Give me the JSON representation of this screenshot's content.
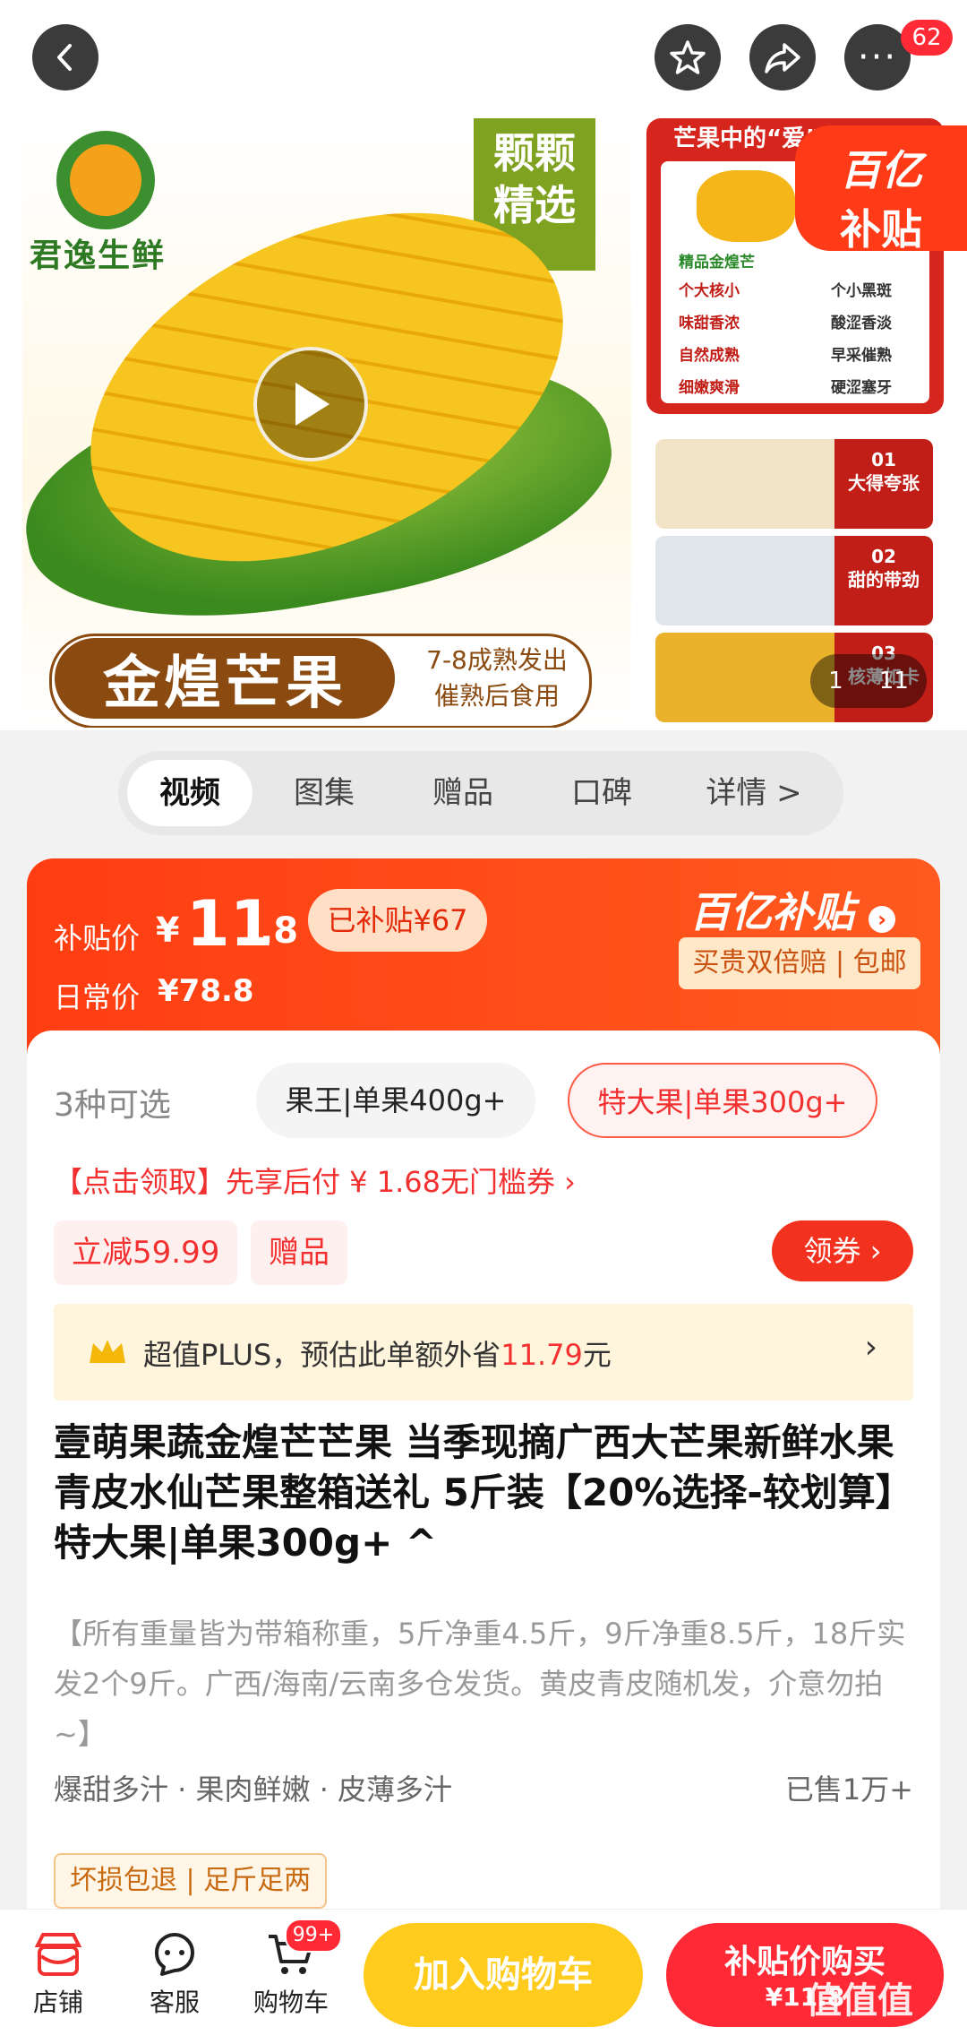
{
  "header": {
    "notification_count": "62"
  },
  "gallery": {
    "brand_name": "君逸生鲜",
    "select_tag": "颗颗精选",
    "product_banner": "金煌芒果",
    "ripe_note_1": "7-8成熟发出",
    "ripe_note_2": "催熟后食用",
    "side_title": "芒果中的“爱”",
    "side_good": [
      "精品金煌芒",
      "个大核小",
      "味甜香浓",
      "自然成熟",
      "细嫩爽滑"
    ],
    "side_bad": [
      "个小黑斑",
      "酸涩香淡",
      "早采催熟",
      "硬涩塞牙"
    ],
    "yi_badge_line1": "百亿",
    "yi_badge_line2": "补贴",
    "thumbs": [
      {
        "num": "01",
        "label": "大得夸张"
      },
      {
        "num": "02",
        "label": "甜的带劲"
      },
      {
        "num": "03",
        "label": "核薄如卡"
      }
    ],
    "page_current": "1",
    "page_total": "11"
  },
  "tabs": [
    "视频",
    "图集",
    "赠品",
    "口碑",
    "详情 >"
  ],
  "price": {
    "subsidy_label": "补贴价",
    "currency": "¥",
    "subsidy_int": "11",
    "subsidy_dec": ".8",
    "subsidized_badge": "已补贴¥67",
    "daily_label": "日常价",
    "daily_price": "¥78.8",
    "yi_title": "百亿补贴",
    "yi_sub": "买贵双倍赔 | 包邮"
  },
  "specs": {
    "count_label": "3种可选",
    "options": [
      "果王|单果400g+",
      "特大果|单果300g+"
    ]
  },
  "coupon": {
    "text": "【点击领取】先享后付 ¥ 1.68无门槛券 ›",
    "discount": "立减59.99",
    "gift": "赠品",
    "get_coupon": "领券"
  },
  "plus": {
    "text_prefix": "超值PLUS，预估此单额外省",
    "amount": "11.79",
    "text_suffix": "元"
  },
  "product": {
    "title": "壹萌果蔬金煌芒芒果 当季现摘广西大芒果新鲜水果青皮水仙芒果整箱送礼 5斤装【20%选择-较划算】 特大果|单果300g+ ^",
    "desc": "【所有重量皆为带箱称重，5斤净重4.5斤，9斤净重8.5斤，18斤实发2个9斤。广西/海南/云南多仓发货。黄皮青皮随机发，介意勿拍~】",
    "features": "爆甜多汁 · 果肉鲜嫩 · 皮薄多汁",
    "sold": "已售1万+",
    "guarantee": "坏损包退 | 足斤足两"
  },
  "bottom_bar": {
    "shop": "店铺",
    "service": "客服",
    "cart": "购物车",
    "cart_badge": "99+",
    "add_cart": "加入购物车",
    "buy_label": "补贴价购买",
    "buy_price": "¥11.8"
  },
  "watermark": "值值值"
}
